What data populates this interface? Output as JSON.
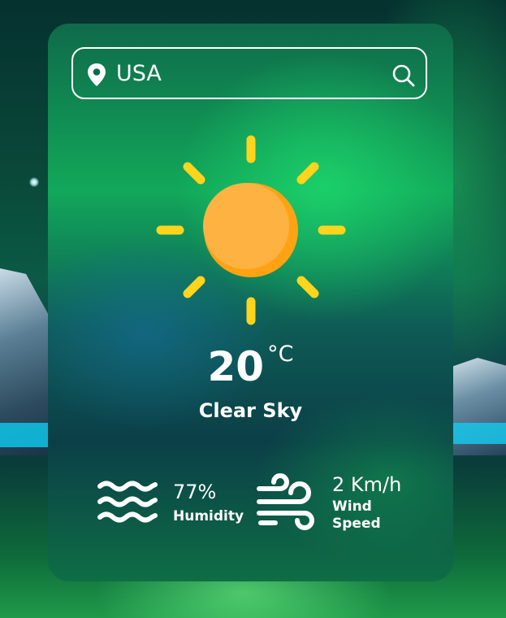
{
  "search": {
    "value": "USA",
    "pin_icon": "location-pin-icon",
    "search_icon": "search-icon"
  },
  "weather": {
    "icon": "clear-sky-sun-icon",
    "temperature": "20",
    "unit": "°C",
    "condition": "Clear Sky"
  },
  "details": {
    "humidity": {
      "value": "77%",
      "label": "Humidity",
      "icon": "humidity-waves-icon"
    },
    "wind": {
      "value": "2 Km/h",
      "label": "Wind Speed",
      "icon": "wind-icon"
    }
  },
  "colors": {
    "sun_body": "#FDB241",
    "sun_shade": "#FDA313",
    "sun_rays": "#FFD41D",
    "text": "#FFFFFF"
  }
}
